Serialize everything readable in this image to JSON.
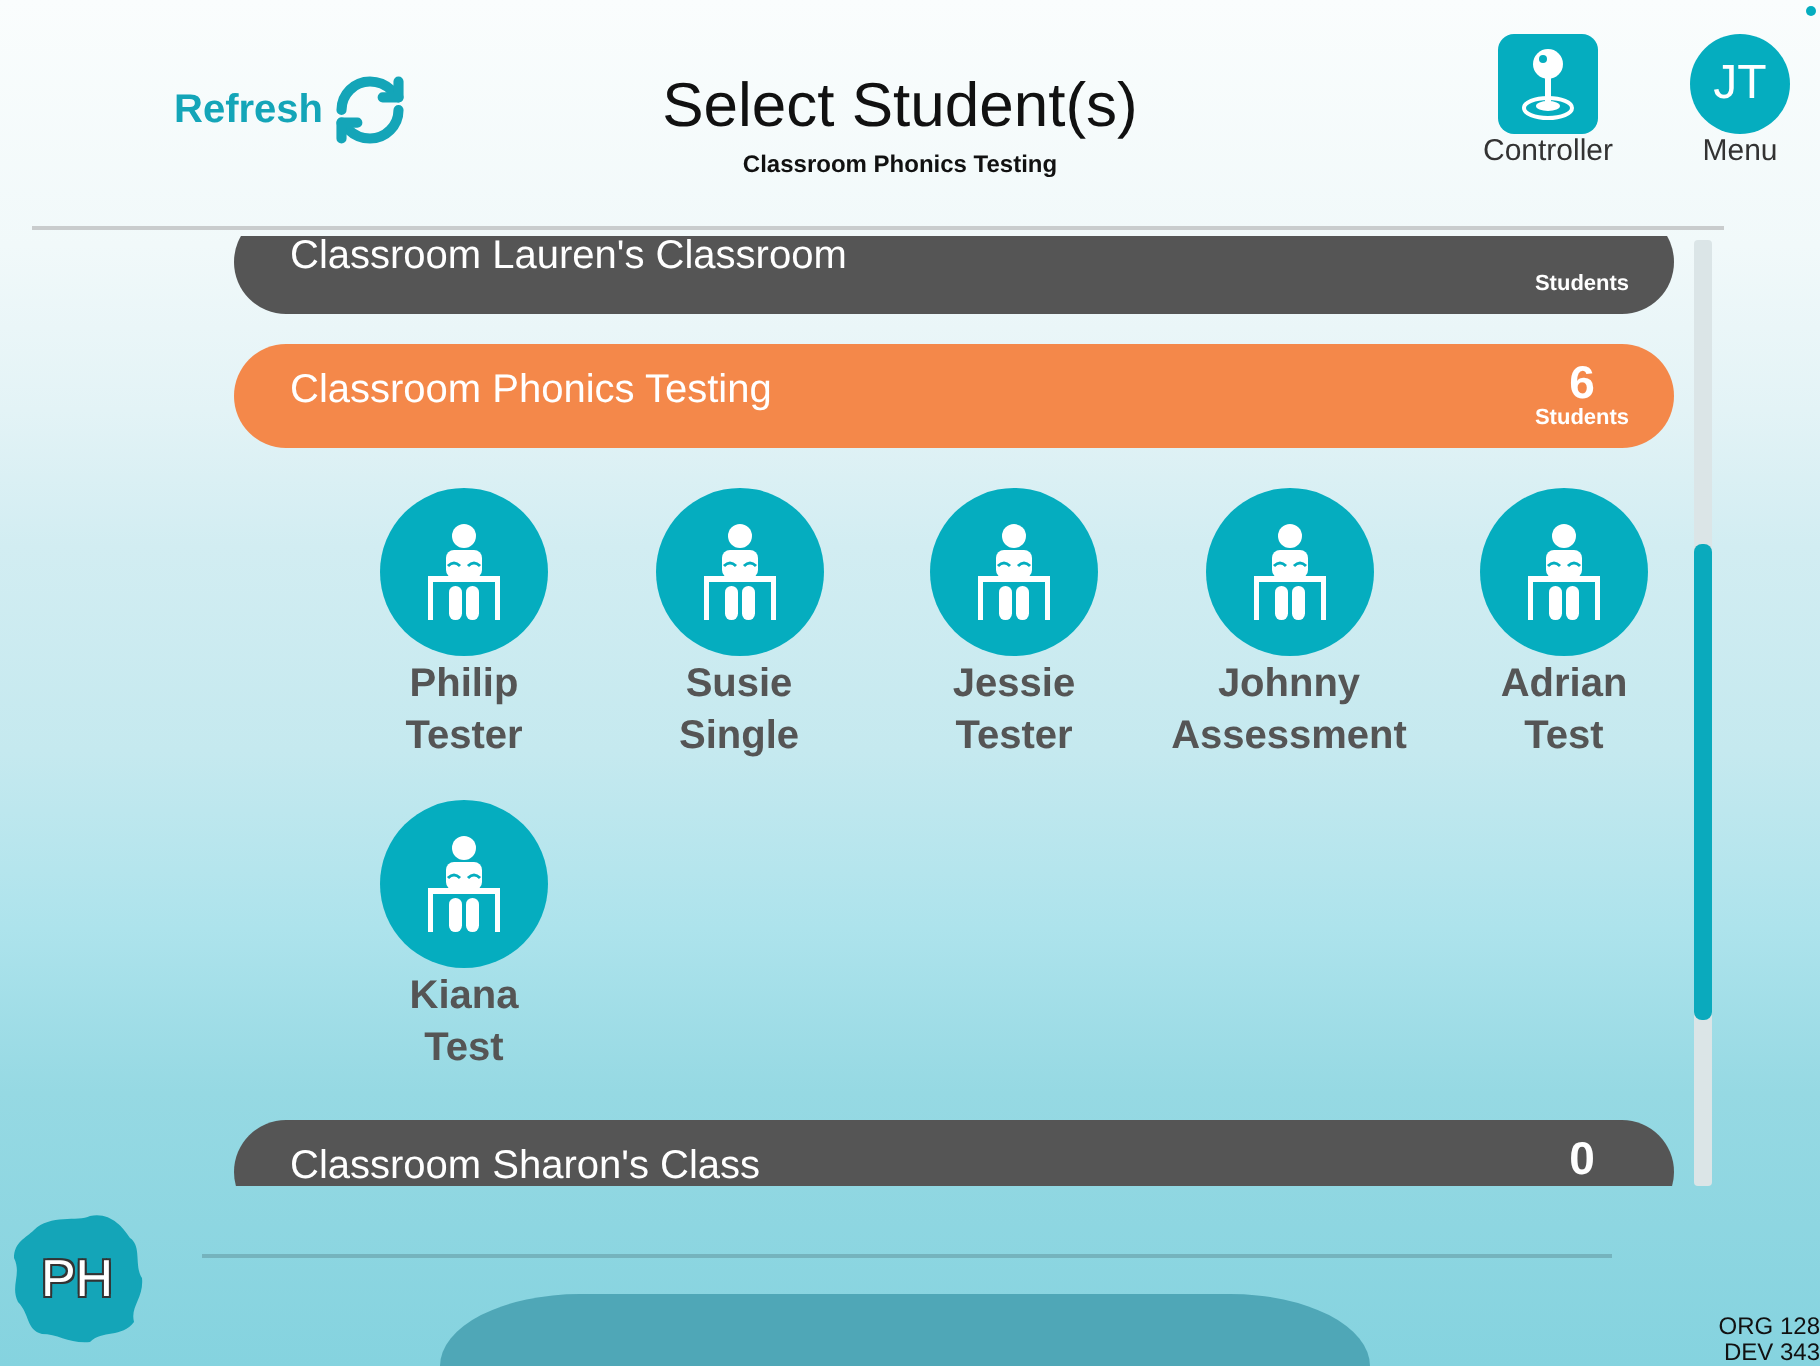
{
  "header": {
    "refresh": {
      "label": "Refresh"
    },
    "title": "Select Student(s)",
    "subtitle": "Classroom Phonics Testing",
    "controller": {
      "label": "Controller"
    },
    "menu": {
      "initials": "JT",
      "label": "Menu"
    }
  },
  "classrooms": [
    {
      "name": "Classroom Lauren's Classroom",
      "count_label": "Students",
      "expanded": false
    },
    {
      "name": "Classroom Phonics Testing",
      "count": "6",
      "count_label": "Students",
      "expanded": true,
      "students": [
        {
          "first_name": "Philip",
          "last_name": "Tester"
        },
        {
          "first_name": "Susie",
          "last_name": "Single"
        },
        {
          "first_name": "Jessie",
          "last_name": "Tester"
        },
        {
          "first_name": "Johnny",
          "last_name": "Assessment"
        },
        {
          "first_name": "Adrian",
          "last_name": "Test"
        },
        {
          "first_name": "Kiana",
          "last_name": "Test"
        }
      ]
    },
    {
      "name": "Classroom Sharon's Class",
      "count": "0",
      "expanded": false
    }
  ],
  "footer": {
    "logo": "PH",
    "org": "ORG 128",
    "dev": "DEV 343"
  }
}
